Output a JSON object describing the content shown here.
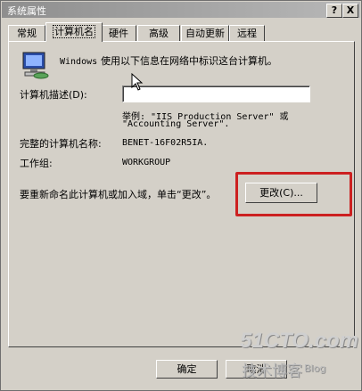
{
  "window": {
    "title": "系统属性",
    "help_btn": "?",
    "close_btn": "X"
  },
  "tabs": [
    {
      "label": "常规"
    },
    {
      "label": "计算机名"
    },
    {
      "label": "硬件"
    },
    {
      "label": "高级"
    },
    {
      "label": "自动更新"
    },
    {
      "label": "远程"
    }
  ],
  "computer_name_tab": {
    "intro_prefix": "Windows",
    "intro_text": "使用以下信息在网络中标识这台计算机。",
    "desc_label": "计算机描述(D):",
    "desc_value": "",
    "example_line1": "举例: \"IIS Production Server\" 或",
    "example_line2": "\"Accounting Server\".",
    "fullname_label": "完整的计算机名称:",
    "fullname_value": "BENET-16F02R5IA.",
    "workgroup_label": "工作组:",
    "workgroup_value": "WORKGROUP",
    "rename_text": "要重新命名此计算机或加入域，单击“更改”。",
    "change_btn": "更改(C)..."
  },
  "bottom": {
    "ok_btn": "确定",
    "cancel_btn": "取消"
  },
  "watermark": {
    "line1": "51CTO.com",
    "line2": "技术博客",
    "line3": "Blog"
  },
  "colors": {
    "highlight": "#cc2020",
    "dialog_bg": "#d4d0c8"
  }
}
